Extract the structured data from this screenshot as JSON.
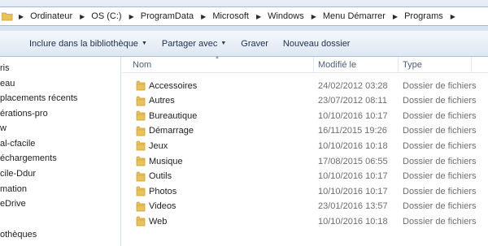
{
  "address": {
    "crumbs": [
      "Ordinateur",
      "OS (C:)",
      "ProgramData",
      "Microsoft",
      "Windows",
      "Menu Démarrer",
      "Programs"
    ]
  },
  "toolbar": {
    "library_label": "Inclure dans la bibliothèque",
    "share_label": "Partager avec",
    "burn_label": "Graver",
    "new_folder_label": "Nouveau dossier"
  },
  "nav": {
    "items": [
      "ris",
      "eau",
      "placements récents",
      "érations-pro",
      "w",
      "al-cfacile",
      "échargements",
      "cile-Ddur",
      "mation",
      "eDrive",
      "othèques"
    ]
  },
  "columns": {
    "name": "Nom",
    "modified": "Modifié le",
    "type": "Type"
  },
  "files": [
    {
      "name": "Accessoires",
      "date": "24/02/2012 03:28",
      "type": "Dossier de fichiers"
    },
    {
      "name": "Autres",
      "date": "23/07/2012 08:11",
      "type": "Dossier de fichiers"
    },
    {
      "name": "Bureautique",
      "date": "10/10/2016 10:17",
      "type": "Dossier de fichiers"
    },
    {
      "name": "Démarrage",
      "date": "16/11/2015 19:26",
      "type": "Dossier de fichiers"
    },
    {
      "name": "Jeux",
      "date": "10/10/2016 10:18",
      "type": "Dossier de fichiers"
    },
    {
      "name": "Musique",
      "date": "17/08/2015 06:55",
      "type": "Dossier de fichiers"
    },
    {
      "name": "Outils",
      "date": "10/10/2016 10:17",
      "type": "Dossier de fichiers"
    },
    {
      "name": "Photos",
      "date": "10/10/2016 10:17",
      "type": "Dossier de fichiers"
    },
    {
      "name": "Videos",
      "date": "23/01/2016 13:57",
      "type": "Dossier de fichiers"
    },
    {
      "name": "Web",
      "date": "10/10/2016 10:18",
      "type": "Dossier de fichiers"
    }
  ],
  "colors": {
    "folder": "#e8c25a",
    "folder_dark": "#c99a2a",
    "header_text": "#4c607a"
  }
}
